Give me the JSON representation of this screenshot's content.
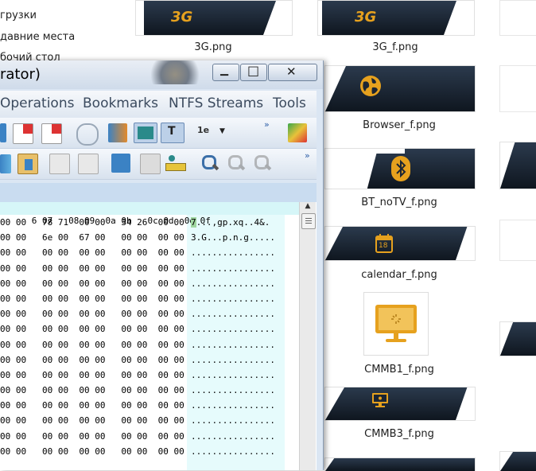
{
  "sidebar": {
    "items": [
      {
        "label": "грузки"
      },
      {
        "label": "давние места"
      },
      {
        "label": "бочий стол"
      }
    ]
  },
  "files": [
    {
      "name": "3G.png",
      "icon": "3g-text-icon"
    },
    {
      "name": "3G_f.png",
      "icon": "3g-text-icon"
    },
    {
      "name": "Browser_f.png",
      "icon": "globe-icon"
    },
    {
      "name": "BT_noTV_f.png",
      "icon": "bluetooth-icon"
    },
    {
      "name": "calendar_f.png",
      "icon": "calendar-icon"
    },
    {
      "name": "CMMB1_f.png",
      "icon": "monitor-icon"
    },
    {
      "name": "CMMB3_f.png",
      "icon": "monitor-icon"
    }
  ],
  "tile_labels": {
    "g3": "3G",
    "cal_day": "18"
  },
  "window": {
    "title": "rator)",
    "buttons": {
      "minimize": "▁",
      "maximize": "□",
      "close": "✕"
    },
    "menu": [
      "Operations",
      "Bookmarks",
      "NTFS Streams",
      "Tools"
    ],
    "chevron": "»"
  },
  "hex": {
    "header": "6 07   08 09  0a 0b   0c 0d  0e 0f",
    "rows": [
      {
        "hex": "00 00   78 71  00 00   34 26  00 00",
        "ascii": "7...,gp.xq..4&."
      },
      {
        "hex": "00 00   6e 00  67 00   00 00  00 00",
        "ascii": "3.G...p.n.g....."
      },
      {
        "hex": "00 00   00 00  00 00   00 00  00 00",
        "ascii": "................"
      },
      {
        "hex": "00 00   00 00  00 00   00 00  00 00",
        "ascii": "................"
      },
      {
        "hex": "00 00   00 00  00 00   00 00  00 00",
        "ascii": "................"
      },
      {
        "hex": "00 00   00 00  00 00   00 00  00 00",
        "ascii": "................"
      },
      {
        "hex": "00 00   00 00  00 00   00 00  00 00",
        "ascii": "................"
      },
      {
        "hex": "00 00   00 00  00 00   00 00  00 00",
        "ascii": "................"
      },
      {
        "hex": "00 00   00 00  00 00   00 00  00 00",
        "ascii": "................"
      },
      {
        "hex": "00 00   00 00  00 00   00 00  00 00",
        "ascii": "................"
      },
      {
        "hex": "00 00   00 00  00 00   00 00  00 00",
        "ascii": "................"
      },
      {
        "hex": "00 00   00 00  00 00   00 00  00 00",
        "ascii": "................"
      },
      {
        "hex": "00 00   00 00  00 00   00 00  00 00",
        "ascii": "................"
      },
      {
        "hex": "00 00   00 00  00 00   00 00  00 00",
        "ascii": "................"
      },
      {
        "hex": "00 00   00 00  00 00   00 00  00 00",
        "ascii": "................"
      },
      {
        "hex": "00 00   00 00  00 00   00 00  00 00",
        "ascii": "................"
      }
    ]
  },
  "colors": {
    "hex_header_bg": "#d6f6f8",
    "tile_dark": "#1b2533",
    "accent_gold": "#e6a11e",
    "window_bg": "#dbe6f3"
  }
}
